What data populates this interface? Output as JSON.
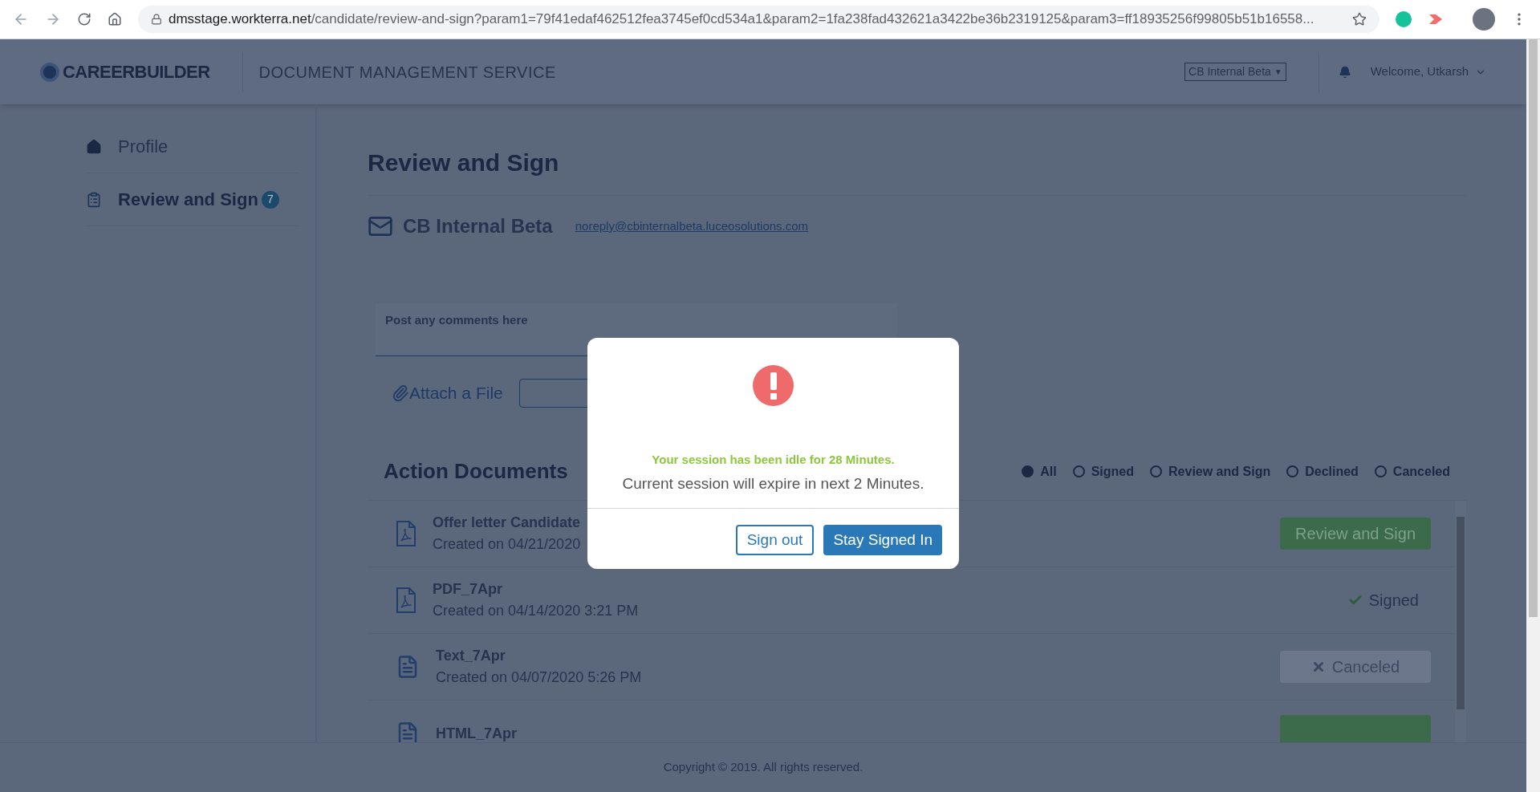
{
  "browser": {
    "url_host": "dmsstage.workterra.net",
    "url_path": "/candidate/review-and-sign?param1=79f41edaf462512fea3745ef0cd534a1&param2=1fa238fad432621a3422be36b2319125&param3=ff18935256f99805b51b16558..."
  },
  "header": {
    "logo": "CAREERBUILDER",
    "service": "DOCUMENT MANAGEMENT SERVICE",
    "tenant": "CB Internal Beta",
    "tenant_caret": "▼",
    "welcome": "Welcome, Utkarsh"
  },
  "sidebar": {
    "items": [
      {
        "label": "Profile",
        "kind": "home",
        "selected": false
      },
      {
        "label": "Review and Sign",
        "kind": "clipboard",
        "selected": true,
        "badge": "7"
      }
    ]
  },
  "main": {
    "title": "Review and Sign",
    "sender": "CB Internal Beta",
    "email": "noreply@cbinternalbeta.luceosolutions.com",
    "comment_placeholder": "Post any comments here",
    "attach": "Attach a File"
  },
  "documents": {
    "title": "Action Documents",
    "filters": [
      {
        "label": "All",
        "selected": true
      },
      {
        "label": "Signed",
        "selected": false
      },
      {
        "label": "Review and Sign",
        "selected": false
      },
      {
        "label": "Declined",
        "selected": false
      },
      {
        "label": "Canceled",
        "selected": false
      }
    ],
    "rows": [
      {
        "name": "Offer letter Candidate",
        "created": "Created on 04/21/2020",
        "kind": "pdf",
        "action": {
          "kind": "review",
          "label": "Review and Sign"
        }
      },
      {
        "name": "PDF_7Apr",
        "created": "Created on 04/14/2020 3:21 PM",
        "kind": "pdf",
        "action": {
          "kind": "signed",
          "label": "Signed"
        }
      },
      {
        "name": "Text_7Apr",
        "created": "Created on 04/07/2020 5:26 PM",
        "kind": "text",
        "action": {
          "kind": "canceled",
          "label": "Canceled"
        }
      },
      {
        "name": "HTML_7Apr",
        "kind": "text",
        "action": {
          "kind": "review"
        }
      }
    ]
  },
  "footer": "Copyright © 2019. All rights reserved.",
  "dialog": {
    "idle": "Your session has been idle for 28 Minutes.",
    "expire": "Current session will expire in next 2 Minutes.",
    "buttons": [
      {
        "label": "Sign out",
        "kind": "outline"
      },
      {
        "label": "Stay Signed In",
        "kind": "primary"
      }
    ]
  }
}
